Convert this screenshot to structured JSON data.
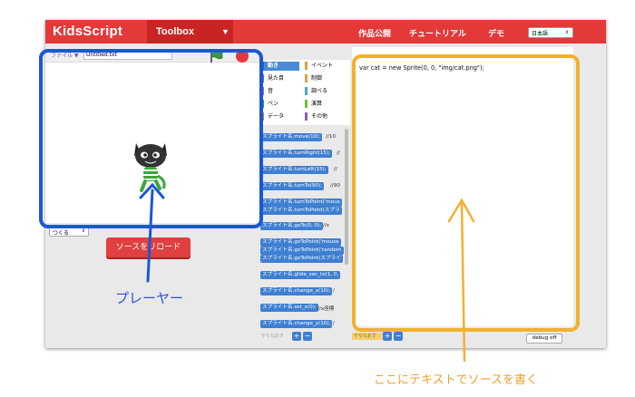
{
  "header": {
    "logo": "KidsScript",
    "toolbox_label": "Toolbox",
    "nav": [
      "作品公開",
      "チュートリアル",
      "デモ"
    ],
    "language": "日本語"
  },
  "player": {
    "file_menu": "ファイル ▼",
    "file_name": "Untitled.txt",
    "create_select": "つくる",
    "reload_label": "ソースをリロード"
  },
  "categories": [
    {
      "label": "動き",
      "color": "#4a8bd6"
    },
    {
      "label": "イベント",
      "color": "#d8a23a"
    },
    {
      "label": "見た目",
      "color": "#8a5cc7"
    },
    {
      "label": "制御",
      "color": "#e0a040"
    },
    {
      "label": "音",
      "color": "#c05ac8"
    },
    {
      "label": "調べる",
      "color": "#4fa3d8"
    },
    {
      "label": "ペン",
      "color": "#2e9e3a"
    },
    {
      "label": "演算",
      "color": "#6cbf3a"
    },
    {
      "label": "データ",
      "color": "#e07a2a"
    },
    {
      "label": "その他",
      "color": "#8a5cc7"
    }
  ],
  "blocks": [
    {
      "code": "スプライト名.move(10);",
      "comment": "//10"
    },
    {
      "code": "スプライト名.turnRight(15);",
      "comment": "//"
    },
    {
      "code": "スプライト名.turnLeft(15);",
      "comment": "//"
    },
    {
      "code": "スプライト名.turnTo(90);",
      "comment": "//90"
    },
    {
      "code": "スプライト名.turnToPoint('mous",
      "comment": ""
    },
    {
      "code": "スプライト名.turnToPoint(スプラ",
      "comment": ""
    },
    {
      "code": "スプライト名.goTo(0, 0);",
      "comment": "//x"
    },
    {
      "code": "スプライト名.goToPoint('mouse",
      "comment": ""
    },
    {
      "code": "スプライト名.goToPoint('random",
      "comment": ""
    },
    {
      "code": "スプライト名.goToPoint(スプライ",
      "comment": ""
    },
    {
      "code": "スプライト名.glide_sec_to(1, 0,",
      "comment": ""
    },
    {
      "code": "スプライト名.change_x(10);",
      "comment": "/"
    },
    {
      "code": "スプライト名.set_x(0);",
      "comment": "//x座標"
    },
    {
      "code": "スプライト名.change_y(10);",
      "comment": "/"
    }
  ],
  "editor": {
    "code": "var cat = new Sprite(0, 0, \"img/cat.png\");"
  },
  "footer": {
    "undo_left": "やりなおす",
    "undo_right": "やりなおす",
    "plus": "+",
    "minus": "−",
    "debug": "debug off"
  },
  "annotations": {
    "player": "プレーヤー",
    "source": "ここにテキストでソースを書く"
  },
  "colors": {
    "header": "#e53838",
    "player_highlight": "#1b57d8",
    "editor_highlight": "#f3b030"
  }
}
